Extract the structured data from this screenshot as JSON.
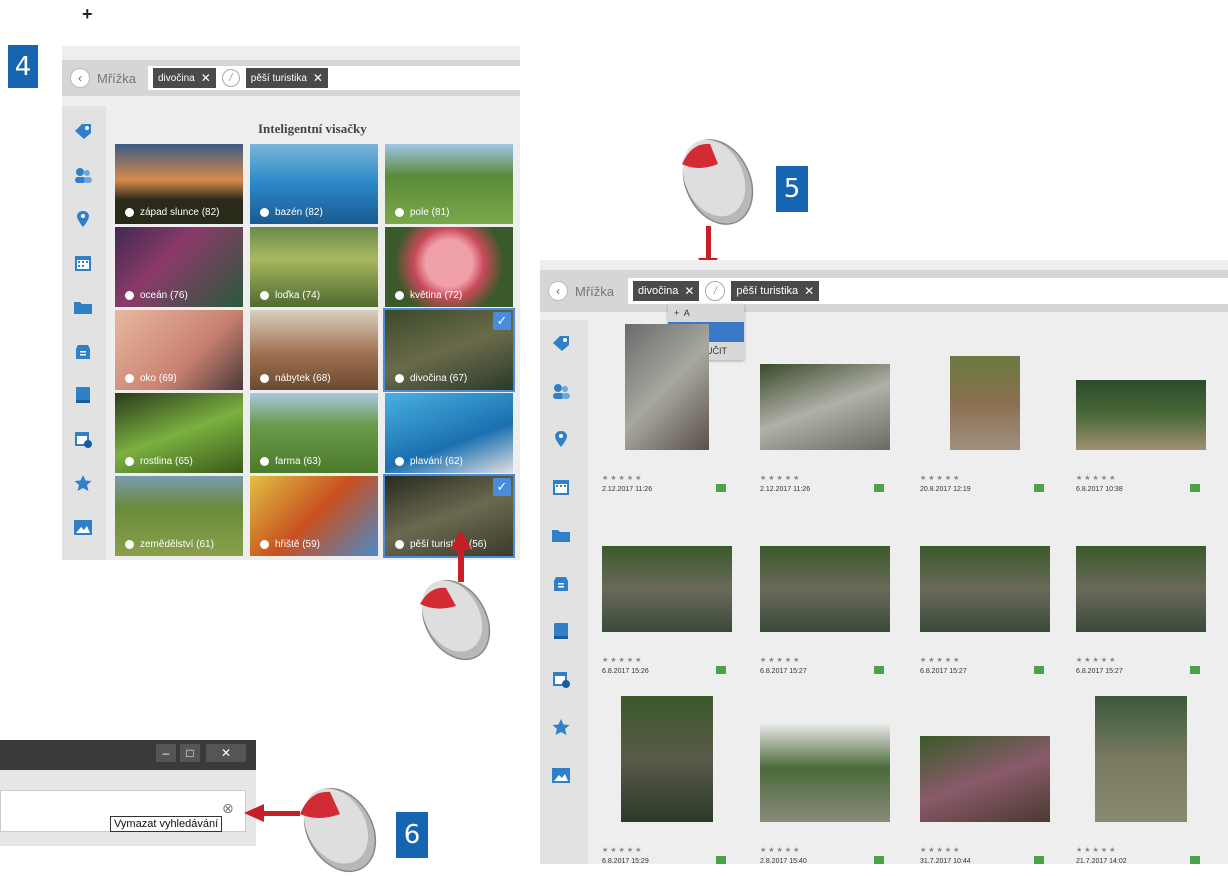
{
  "plus_sign": "+",
  "steps": [
    "4",
    "5",
    "6"
  ],
  "panel4": {
    "crumb": "Mřížka",
    "tags": [
      "divočina",
      "pěší turistika"
    ],
    "operator": "/",
    "heading": "Inteligentní visačky",
    "tiles": [
      {
        "label": "západ slunce (82)",
        "checked": false
      },
      {
        "label": "bazén (82)",
        "checked": false
      },
      {
        "label": "pole (81)",
        "checked": false
      },
      {
        "label": "oceán (76)",
        "checked": false
      },
      {
        "label": "loďka (74)",
        "checked": false
      },
      {
        "label": "květina (72)",
        "checked": false
      },
      {
        "label": "oko (69)",
        "checked": false
      },
      {
        "label": "nábytek (68)",
        "checked": false
      },
      {
        "label": "divočina (67)",
        "checked": true
      },
      {
        "label": "rostlina (65)",
        "checked": false
      },
      {
        "label": "farma (63)",
        "checked": false
      },
      {
        "label": "plavání (62)",
        "checked": false
      },
      {
        "label": "zemědělství (61)",
        "checked": false
      },
      {
        "label": "hřiště (59)",
        "checked": false
      },
      {
        "label": "pěší turistika (56)",
        "checked": true
      }
    ]
  },
  "panel5": {
    "crumb": "Mřížka",
    "tags": [
      "divočina",
      "pěší turistika"
    ],
    "operator": "/",
    "dropdown": [
      "+  A",
      "/  NEBO",
      "-  VYLOUČIT"
    ],
    "dropdown_selected": 1,
    "stars": "★★★★★",
    "photos": [
      {
        "date": "2.12.2017 11:26"
      },
      {
        "date": "2.12.2017 11:26"
      },
      {
        "date": "20.8.2017 12:19"
      },
      {
        "date": "6.8.2017 10:38"
      },
      {
        "date": "6.8.2017 15:26"
      },
      {
        "date": "6.8.2017 15:27"
      },
      {
        "date": "6.8.2017 15:27"
      },
      {
        "date": "6.8.2017 15:27"
      },
      {
        "date": "6.8.2017 15:29"
      },
      {
        "date": "2.8.2017 15:40"
      },
      {
        "date": "31.7.2017 10:44"
      },
      {
        "date": "21.7.2017 14:02"
      }
    ]
  },
  "panel6": {
    "window_buttons": [
      "–",
      "□",
      "✕"
    ],
    "clear_icon": "⊗",
    "tooltip": "Vymazat vyhledávání"
  },
  "colors": {
    "accent": "#1565b0",
    "arrow": "#c81e28",
    "tag": "#4a4a4a",
    "check": "#4a8bdc",
    "flag": "#4aa34a"
  }
}
